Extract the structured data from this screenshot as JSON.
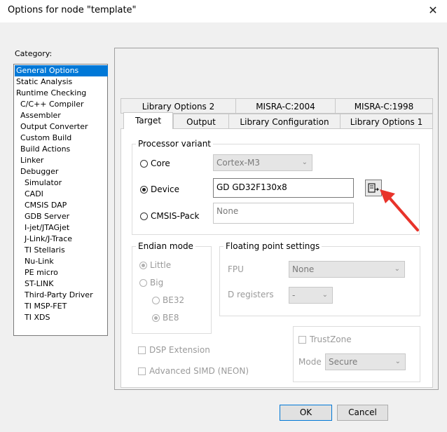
{
  "window": {
    "title": "Options for node \"template\"",
    "close_glyph": "✕"
  },
  "category": {
    "label": "Category:",
    "items": [
      "General Options",
      "Static Analysis",
      "Runtime Checking",
      "C/C++ Compiler",
      "Assembler",
      "Output Converter",
      "Custom Build",
      "Build Actions",
      "Linker",
      "Debugger",
      "Simulator",
      "CADI",
      "CMSIS DAP",
      "GDB Server",
      "I-jet/JTAGjet",
      "J-Link/J-Trace",
      "TI Stellaris",
      "Nu-Link",
      "PE micro",
      "ST-LINK",
      "Third-Party Driver",
      "TI MSP-FET",
      "TI XDS"
    ],
    "selected": "General Options"
  },
  "tabs": {
    "row1": [
      "Library Options 2",
      "MISRA-C:2004",
      "MISRA-C:1998"
    ],
    "row2": [
      "Target",
      "Output",
      "Library Configuration",
      "Library Options 1"
    ],
    "active": "Target"
  },
  "processor": {
    "group_title": "Processor variant",
    "core_label": "Core",
    "core_value": "Cortex-M3",
    "device_label": "Device",
    "device_value": "GD GD32F130x8",
    "cmsis_label": "CMSIS-Pack",
    "cmsis_value": "None",
    "selected": "Device"
  },
  "endian": {
    "group_title": "Endian mode",
    "little": "Little",
    "big": "Big",
    "be32": "BE32",
    "be8": "BE8"
  },
  "float": {
    "group_title": "Floating point settings",
    "fpu_label": "FPU",
    "fpu_value": "None",
    "dreg_label": "D registers",
    "dreg_value": "-"
  },
  "options": {
    "dsp": "DSP Extension",
    "simd": "Advanced SIMD (NEON)"
  },
  "trustzone": {
    "label": "TrustZone",
    "mode_label": "Mode",
    "mode_value": "Secure"
  },
  "buttons": {
    "ok": "OK",
    "cancel": "Cancel"
  },
  "icons": {
    "device_select": "chip-select-icon",
    "dropdown": "chevron-down-icon",
    "annotation": "red-arrow-icon"
  },
  "colors": {
    "selection": "#0078d7",
    "annotation_arrow": "#e8332a"
  }
}
